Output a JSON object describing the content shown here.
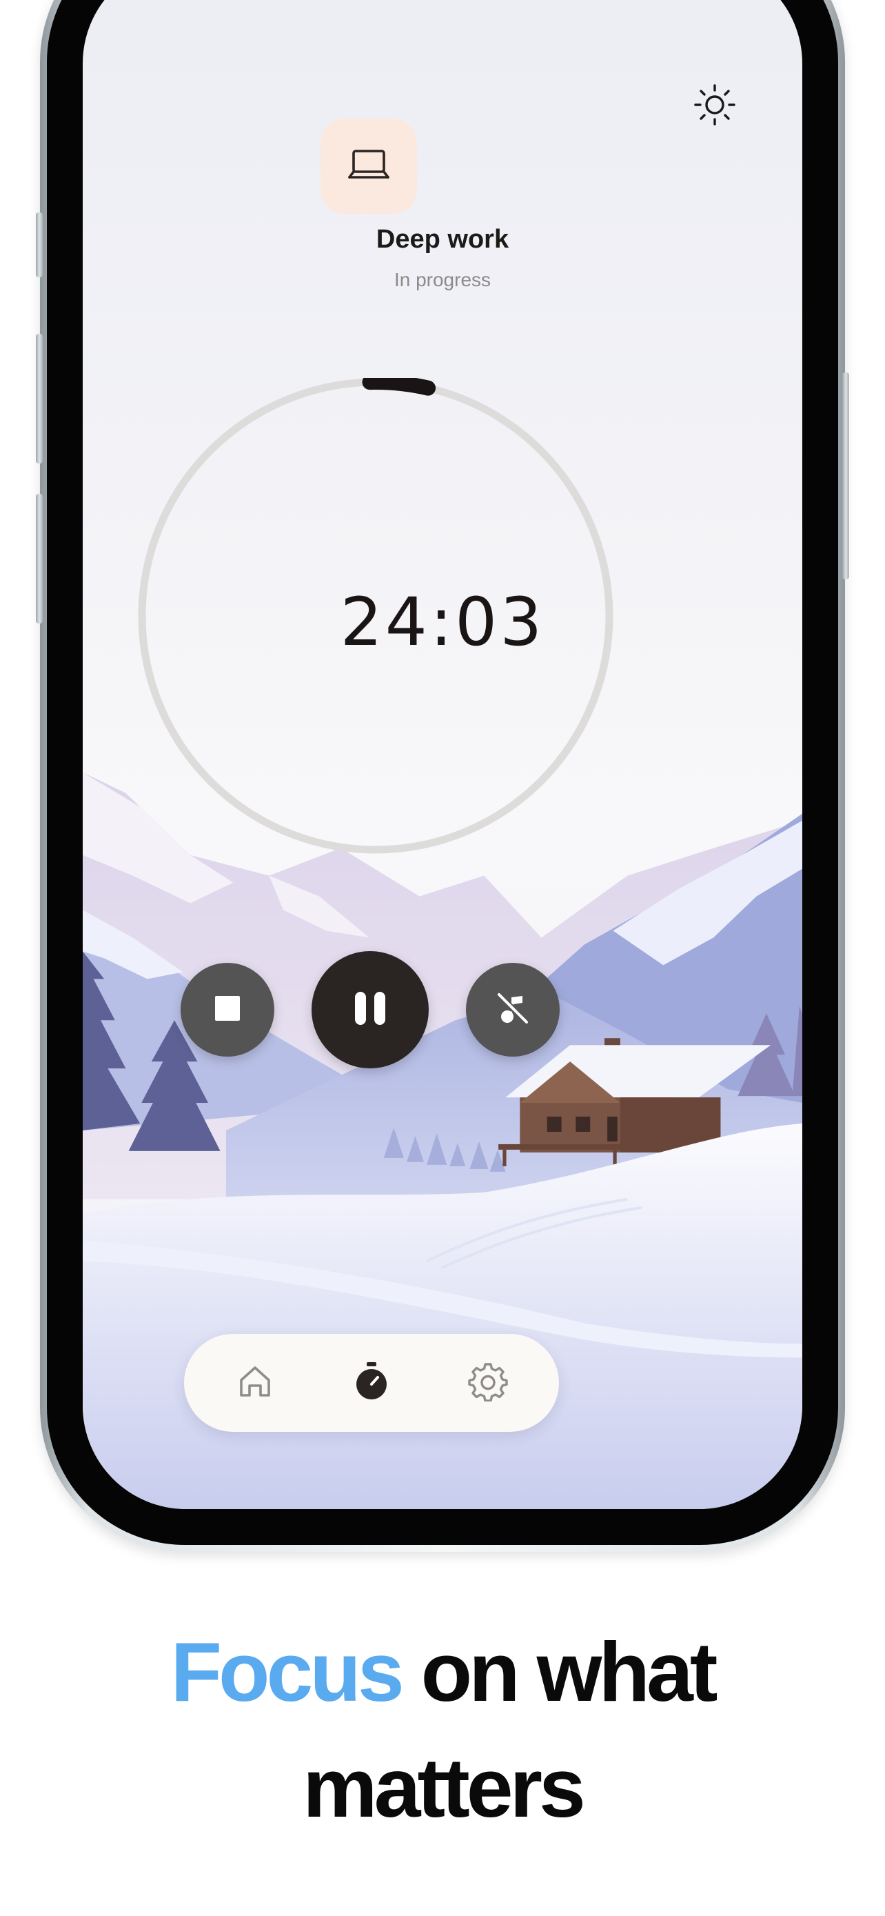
{
  "session": {
    "title": "Deep work",
    "status": "In progress",
    "icon": "laptop-icon",
    "timer": "24:03",
    "progress": 0.04
  },
  "header": {
    "theme_icon": "sun-icon"
  },
  "controls": {
    "stop_icon": "stop-icon",
    "pause_icon": "pause-icon",
    "music_icon": "music-off-icon"
  },
  "tabbar": {
    "items": [
      {
        "icon": "home-icon",
        "active": false
      },
      {
        "icon": "stopwatch-icon",
        "active": true
      },
      {
        "icon": "gear-icon",
        "active": false
      }
    ]
  },
  "caption": {
    "accent_word": "Focus",
    "line1_rest": " on what",
    "line2": "matters"
  },
  "colors": {
    "accent": "#5aaaf0",
    "tile_bg": "#fbe9df",
    "button_dark": "#2a2523",
    "button_gray": "#555454",
    "ring_track": "#dddcdb",
    "ring_progress": "#1a1514"
  }
}
